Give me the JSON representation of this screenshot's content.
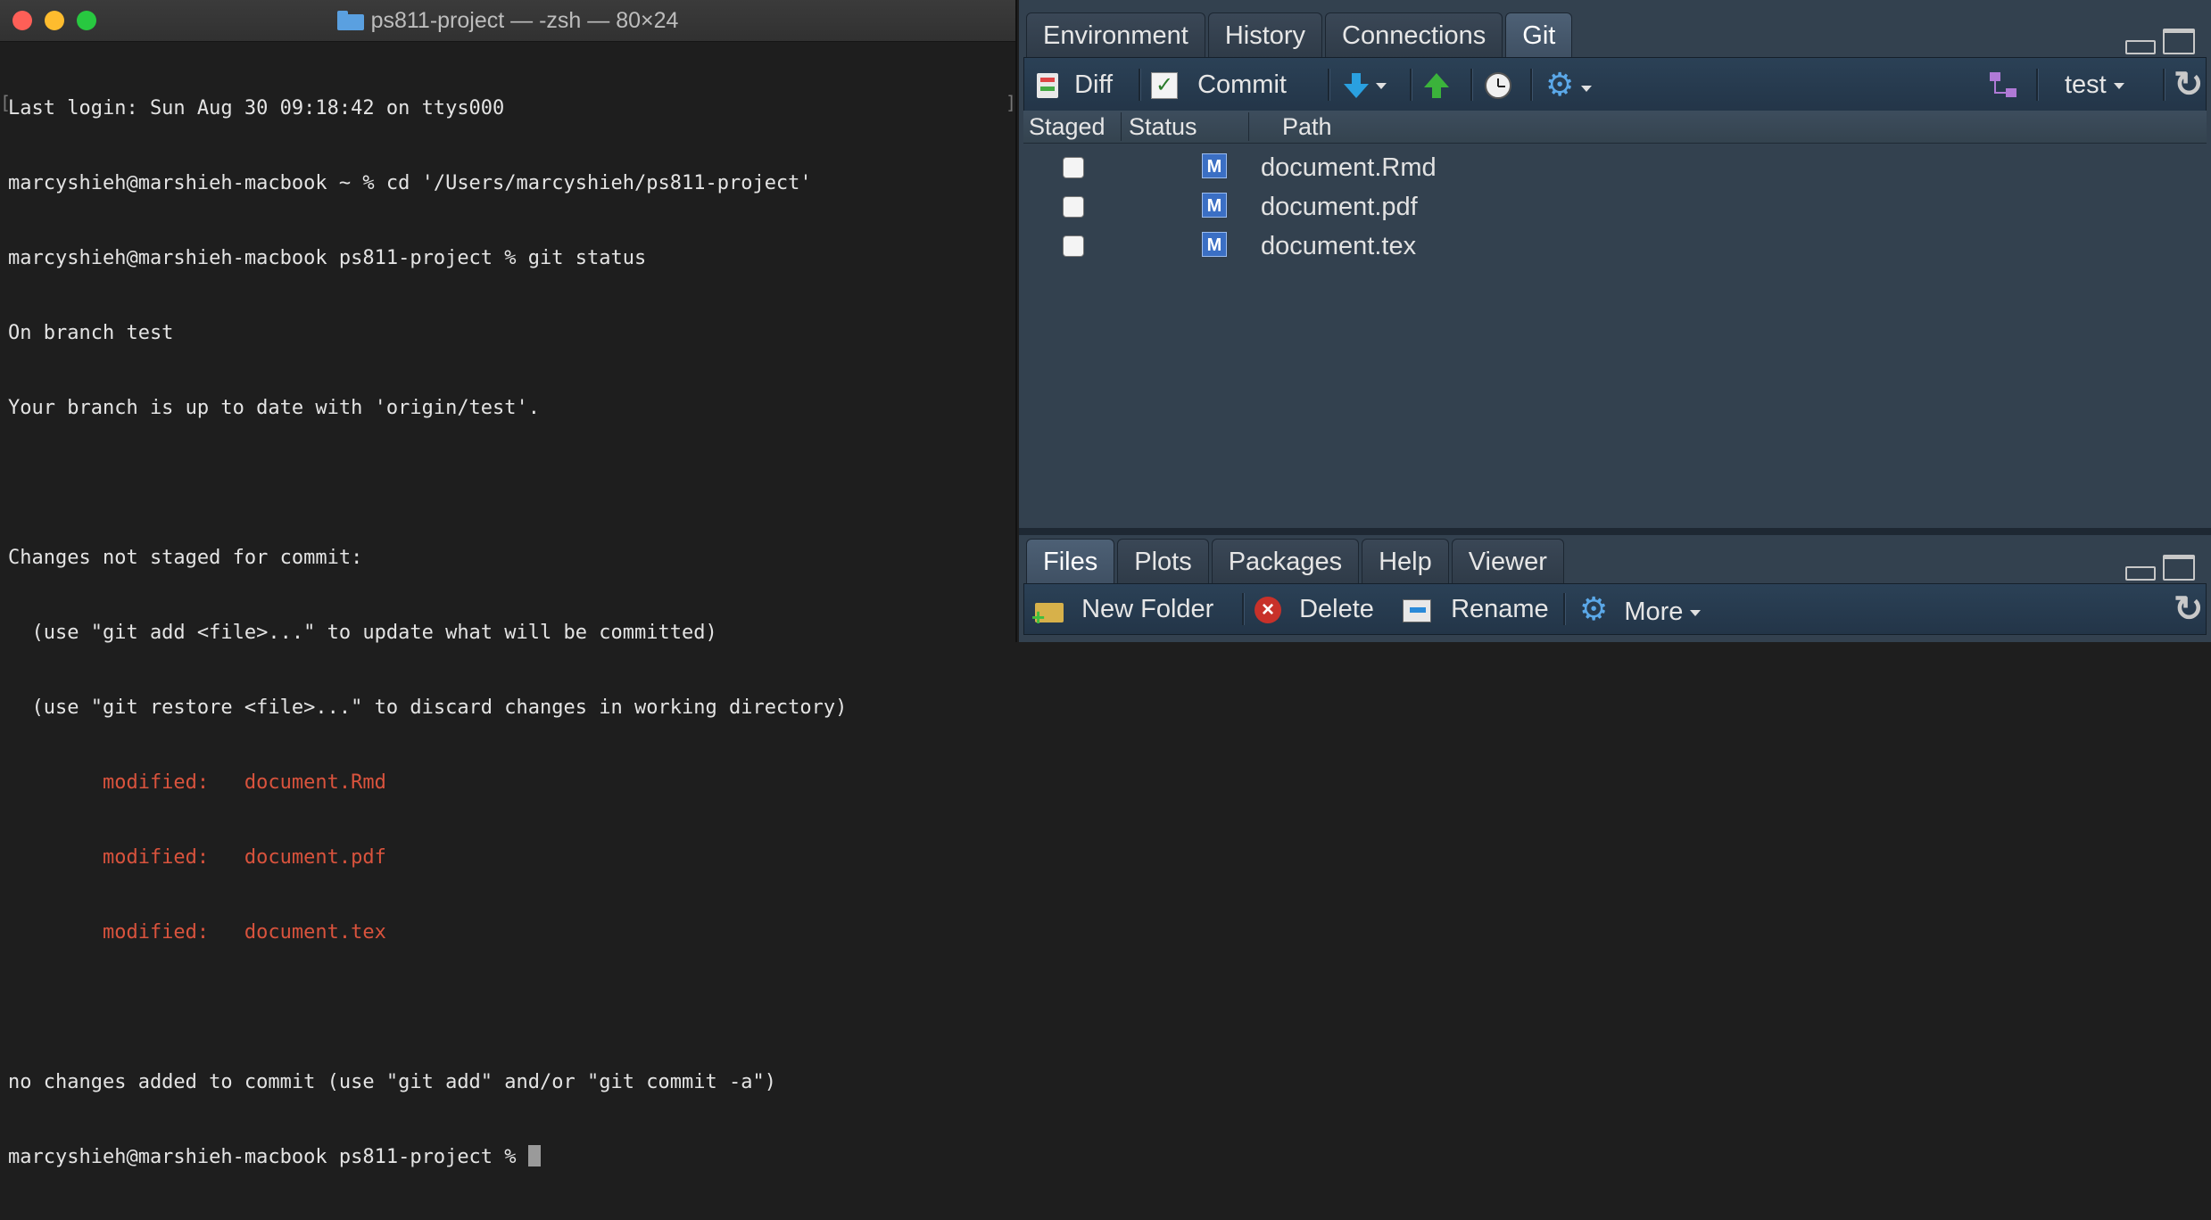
{
  "terminal": {
    "title": "ps811-project — -zsh — 80×24",
    "lines": [
      {
        "text": "Last login: Sun Aug 30 09:18:42 on ttys000",
        "style": "normal"
      },
      {
        "text": "marcyshieh@marshieh-macbook ~ % cd '/Users/marcyshieh/ps811-project'",
        "style": "normal"
      },
      {
        "text": "marcyshieh@marshieh-macbook ps811-project % git status",
        "style": "normal"
      },
      {
        "text": "On branch test",
        "style": "normal"
      },
      {
        "text": "Your branch is up to date with 'origin/test'.",
        "style": "normal"
      },
      {
        "text": "",
        "style": "normal"
      },
      {
        "text": "Changes not staged for commit:",
        "style": "normal"
      },
      {
        "text": "  (use \"git add <file>...\" to update what will be committed)",
        "style": "normal"
      },
      {
        "text": "  (use \"git restore <file>...\" to discard changes in working directory)",
        "style": "normal"
      },
      {
        "text": "        modified:   document.Rmd",
        "style": "mod"
      },
      {
        "text": "        modified:   document.pdf",
        "style": "mod"
      },
      {
        "text": "        modified:   document.tex",
        "style": "mod"
      },
      {
        "text": "",
        "style": "normal"
      },
      {
        "text": "no changes added to commit (use \"git add\" and/or \"git commit -a\")",
        "style": "normal"
      }
    ],
    "prompt": "marcyshieh@marshieh-macbook ps811-project % "
  },
  "top_pane": {
    "tabs": [
      "Environment",
      "History",
      "Connections",
      "Git"
    ],
    "active_tab": "Git",
    "toolbar": {
      "diff_label": "Diff",
      "commit_label": "Commit",
      "branch": "test"
    },
    "columns": {
      "staged": "Staged",
      "status": "Status",
      "path": "Path"
    },
    "files": [
      {
        "staged": false,
        "status": "M",
        "path": "document.Rmd"
      },
      {
        "staged": false,
        "status": "M",
        "path": "document.pdf"
      },
      {
        "staged": false,
        "status": "M",
        "path": "document.tex"
      }
    ]
  },
  "bottom_pane": {
    "tabs": [
      "Files",
      "Plots",
      "Packages",
      "Help",
      "Viewer"
    ],
    "active_tab": "Files",
    "toolbar": {
      "new_folder": "New Folder",
      "delete": "Delete",
      "rename": "Rename",
      "more": "More"
    }
  },
  "colors": {
    "terminal_bg": "#1e1e1e",
    "terminal_text": "#e4e4e4",
    "modified_text": "#d9533d",
    "rstudio_bg": "#33414f",
    "status_badge": "#3b6fc4"
  },
  "icons": [
    "folder-icon",
    "diff-icon",
    "commit-icon",
    "pull-arrow-icon",
    "push-arrow-icon",
    "history-clock-icon",
    "gear-icon",
    "branch-icon",
    "refresh-icon",
    "new-folder-icon",
    "delete-icon",
    "rename-icon"
  ]
}
